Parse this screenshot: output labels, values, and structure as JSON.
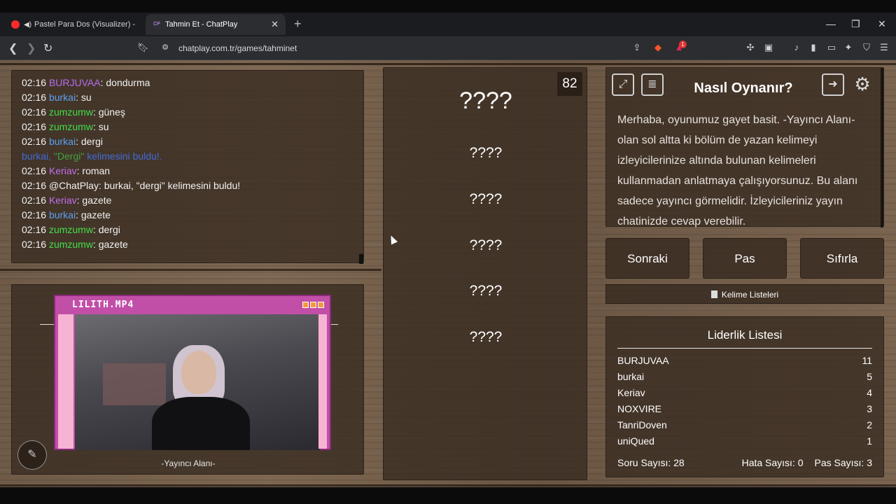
{
  "browser": {
    "tabs": [
      {
        "title": "Pastel Para Dos (Visualizer) - YouT",
        "favicon": "youtube-icon",
        "active": false
      },
      {
        "title": "Tahmin Et - ChatPlay",
        "favicon": "chatplay-icon",
        "active": true
      }
    ],
    "url": "chatplay.com.tr/games/tahminet",
    "notification_badge": "1"
  },
  "chat": {
    "messages": [
      {
        "time": "02:16",
        "user": "BURJUVAA",
        "color": "#b66cf0",
        "text": ": dondurma"
      },
      {
        "time": "02:16",
        "user": "burkai",
        "color": "#5aa0f2",
        "text": ": su"
      },
      {
        "time": "02:16",
        "user": "zumzumw",
        "color": "#3fe04a",
        "text": ": güneş"
      },
      {
        "time": "02:16",
        "user": "zumzumw",
        "color": "#3fe04a",
        "text": ": su"
      },
      {
        "time": "02:16",
        "user": "burkai",
        "color": "#5aa0f2",
        "text": ": dergi"
      },
      {
        "system_prefix": "burkai, ",
        "system_word": "\"Dergi\"",
        "system_suffix": " kelimesini buldu!."
      },
      {
        "time": "02:16",
        "user": "Keriav",
        "color": "#c36ef0",
        "text": ": roman"
      },
      {
        "time": "02:16",
        "user": "@ChatPlay",
        "color": "#f2f2f2",
        "text": ": burkai, \"dergi\" kelimesini buldu!"
      },
      {
        "time": "02:16",
        "user": "Keriav",
        "color": "#c36ef0",
        "text": ": gazete"
      },
      {
        "time": "02:16",
        "user": "burkai",
        "color": "#5aa0f2",
        "text": ": gazete"
      },
      {
        "time": "02:16",
        "user": "zumzumw",
        "color": "#3fe04a",
        "text": ": dergi"
      },
      {
        "time": "02:16",
        "user": "zumzumw",
        "color": "#3fe04a",
        "text": ": gazete"
      }
    ]
  },
  "stream": {
    "player_title": "LILITH.MP4",
    "label": "-Yayıncı Alanı-"
  },
  "words": {
    "counter": "82",
    "main": "????",
    "hidden": [
      "????",
      "????",
      "????",
      "????",
      "????"
    ]
  },
  "howto": {
    "title": "Nasıl Oynanır?",
    "text": "Merhaba, oyunumuz gayet basit. -Yayıncı Alanı- olan sol altta ki bölüm de yazan kelimeyi izleyicilerinize altında bulunan kelimeleri kullanmadan anlatmaya çalışıyorsunuz. Bu alanı sadece yayıncı görmelidir. İzleyicileriniz yayın chatinizde cevap verebilir."
  },
  "controls": {
    "next": "Sonraki",
    "pass": "Pas",
    "reset": "Sıfırla",
    "word_lists": "Kelime Listeleri"
  },
  "leaderboard": {
    "title": "Liderlik Listesi",
    "rows": [
      {
        "name": "BURJUVAA",
        "score": "11"
      },
      {
        "name": "burkai",
        "score": "5"
      },
      {
        "name": "Keriav",
        "score": "4"
      },
      {
        "name": "NOXVIRE",
        "score": "3"
      },
      {
        "name": "TanriDoven",
        "score": "2"
      },
      {
        "name": "uniQued",
        "score": "1"
      }
    ],
    "questions": "Soru Sayısı: 28",
    "errors": "Hata Sayısı: 0",
    "passes": "Pas Sayısı: 3"
  }
}
